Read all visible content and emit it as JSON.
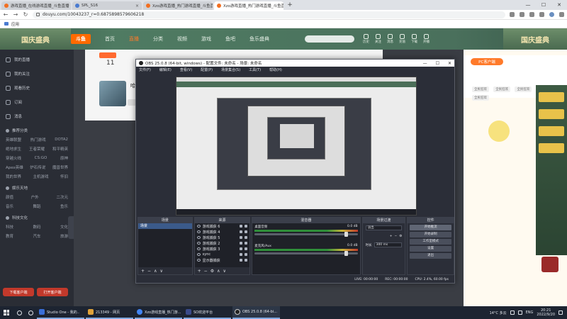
{
  "browser": {
    "tabs": [
      {
        "label": "游戏直播_在线游戏直播_斗鱼直播",
        "active": false
      },
      {
        "label": "SPL_S16",
        "active": false
      },
      {
        "label": "Xzo游戏直播_热门游戏直播_斗鱼直播",
        "active": false
      },
      {
        "label": "Xzo游戏直播_热门游戏直播_斗鱼直播",
        "active": true
      }
    ],
    "new_tab": "+",
    "url": "douyu.com/10043237_r=0.6875898579606218",
    "bookmark": "应用",
    "window_controls": [
      "—",
      "☐",
      "✕"
    ]
  },
  "douyu": {
    "banner_left": "国庆盛典",
    "logo": "斗鱼",
    "nav": [
      "首页",
      "直播",
      "分类",
      "视频",
      "游戏",
      "鱼吧",
      "鱼乐盛典"
    ],
    "nav_active": 1,
    "header_icons": [
      "历史",
      "关注",
      "消息",
      "充值",
      "下载",
      "开播"
    ],
    "banner_right": "国庆盛典",
    "room_number": "11",
    "room_name": "哈哈不知",
    "pc_button": "PC客户端",
    "tags": [
      "全民狂欢",
      "全民狂欢",
      "全民狂欢",
      "全民狂欢"
    ]
  },
  "sidebar": {
    "top_items": [
      "我的直播",
      "我的关注",
      "观看历史",
      "订阅",
      "消息"
    ],
    "sections": [
      {
        "title": "推荐分类",
        "rows": [
          [
            "英雄联盟",
            "热门游戏",
            "DOTA2"
          ],
          [
            "绝地求生",
            "王者荣耀",
            "和平精英"
          ],
          [
            "穿越火线",
            "CS:GO",
            "原神"
          ],
          [
            "Apex英雄",
            "炉石传说",
            "魔兽世界"
          ],
          [
            "我的世界",
            "主机游戏",
            "怀旧"
          ]
        ]
      },
      {
        "title": "娱乐天地",
        "rows": [
          [
            "颜值",
            "户外",
            "二次元"
          ],
          [
            "音乐",
            "舞蹈",
            "鱼乐"
          ]
        ]
      },
      {
        "title": "科技文化",
        "rows": [
          [
            "科技",
            "数码",
            "文化"
          ],
          [
            "教育",
            "汽车",
            "旅游"
          ]
        ]
      }
    ],
    "bottom_buttons": [
      "下载客户端",
      "打开客户端"
    ]
  },
  "obs": {
    "title": "OBS 25.0.8 (64-bit, windows) - 配置文件: 未命名 - 场景: 未命名",
    "menu": [
      "文件(F)",
      "编辑(E)",
      "查看(V)",
      "配置(P)",
      "场景集合(S)",
      "工具(T)",
      "帮助(H)"
    ],
    "docks": {
      "scenes": {
        "title": "场景",
        "items": [
          "场景"
        ]
      },
      "sources": {
        "title": "来源",
        "items": [
          "游戏捕获 6",
          "游戏捕获 4",
          "游戏捕获 5",
          "游戏捕获 2",
          "游戏捕获 3",
          "sync",
          "显示器捕获"
        ]
      },
      "mixer": {
        "title": "混音器",
        "channels": [
          {
            "name": "桌面音频",
            "db": "0.0 dB"
          },
          {
            "name": "麦克风/Aux",
            "db": "0.0 dB"
          }
        ]
      },
      "transitions": {
        "title": "场景过渡",
        "type": "淡出",
        "duration_label": "时长",
        "duration": "300 ms"
      },
      "controls": {
        "title": "控件",
        "buttons": [
          "开始推流",
          "开始录制",
          "工作室模式",
          "设置",
          "退出"
        ]
      }
    },
    "status": {
      "live": "LIVE: 00:00:00",
      "rec": "REC: 00:00:00",
      "cpu": "CPU: 2.4%, 60.00 fps"
    },
    "foot_icons": [
      "+",
      "−",
      "⚙",
      "∧",
      "∨"
    ]
  },
  "taskbar": {
    "tasks": [
      {
        "label": "Studio One - 我的..",
        "color": "#3a6fd8"
      },
      {
        "label": "213349 - 网页",
        "color": "#e0a33a"
      },
      {
        "label": "Xzo游戏直播_热门游...",
        "color": "#4285f4"
      },
      {
        "label": "SO欢迎平台",
        "color": "#3a4a8a"
      },
      {
        "label": "OBS 25.0.8 (64-bi...",
        "color": "#2b2e38"
      }
    ],
    "weather": "14°C 多云",
    "lang": "ENG",
    "time": "20:21",
    "date": "2022/9/20"
  }
}
